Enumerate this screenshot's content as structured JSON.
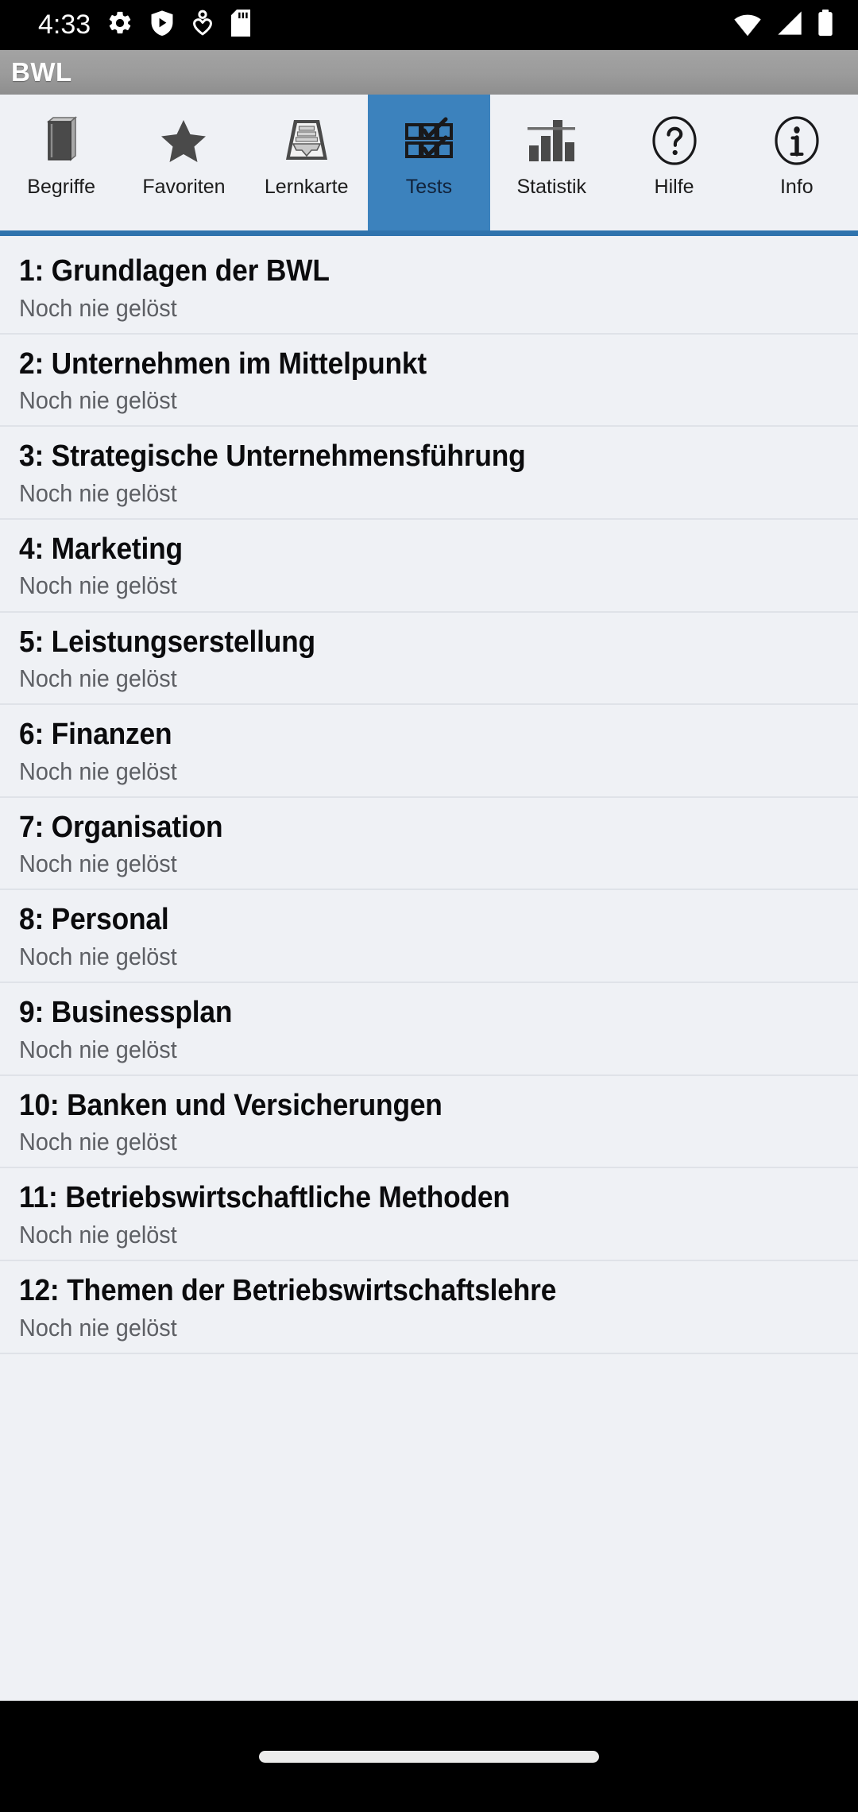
{
  "status_bar": {
    "time": "4:33",
    "left_icons": [
      {
        "name": "settings-gear-icon",
        "glyph": "gear"
      },
      {
        "name": "play-protect-shield-icon",
        "glyph": "shield-play"
      },
      {
        "name": "person-heart-icon",
        "glyph": "person-heart"
      },
      {
        "name": "sd-card-icon",
        "glyph": "sd-card"
      }
    ],
    "right_icons": [
      {
        "name": "wifi-icon",
        "glyph": "wifi"
      },
      {
        "name": "cellular-signal-icon",
        "glyph": "signal"
      },
      {
        "name": "battery-icon",
        "glyph": "battery"
      }
    ]
  },
  "title_bar": {
    "title": "BWL"
  },
  "tabs": {
    "active_index": 3,
    "accent_color": "#3c82bd",
    "underline_color": "#2f73ad",
    "items": [
      {
        "label": "Begriffe",
        "icon": "book-icon"
      },
      {
        "label": "Favoriten",
        "icon": "star-icon"
      },
      {
        "label": "Lernkarte",
        "icon": "card-tray-icon"
      },
      {
        "label": "Tests",
        "icon": "checkbox-grid-icon"
      },
      {
        "label": "Statistik",
        "icon": "bar-chart-icon"
      },
      {
        "label": "Hilfe",
        "icon": "question-circle-icon"
      },
      {
        "label": "Info",
        "icon": "info-circle-icon"
      }
    ]
  },
  "list": {
    "items": [
      {
        "title": "1: Grundlagen der BWL",
        "status": "Noch nie gelöst"
      },
      {
        "title": "2: Unternehmen im Mittelpunkt",
        "status": "Noch nie gelöst"
      },
      {
        "title": "3: Strategische Unternehmensführung",
        "status": "Noch nie gelöst"
      },
      {
        "title": "4: Marketing",
        "status": "Noch nie gelöst"
      },
      {
        "title": "5: Leistungserstellung",
        "status": "Noch nie gelöst"
      },
      {
        "title": "6: Finanzen",
        "status": "Noch nie gelöst"
      },
      {
        "title": "7: Organisation",
        "status": "Noch nie gelöst"
      },
      {
        "title": "8: Personal",
        "status": "Noch nie gelöst"
      },
      {
        "title": "9: Businessplan",
        "status": "Noch nie gelöst"
      },
      {
        "title": "10: Banken und Versicherungen",
        "status": "Noch nie gelöst"
      },
      {
        "title": "11: Betriebswirtschaftliche Methoden",
        "status": "Noch nie gelöst"
      },
      {
        "title": "12: Themen der Betriebswirtschaftslehre",
        "status": "Noch nie gelöst"
      }
    ]
  },
  "nav_bar": {
    "home_indicator": "home-gesture-pill"
  }
}
